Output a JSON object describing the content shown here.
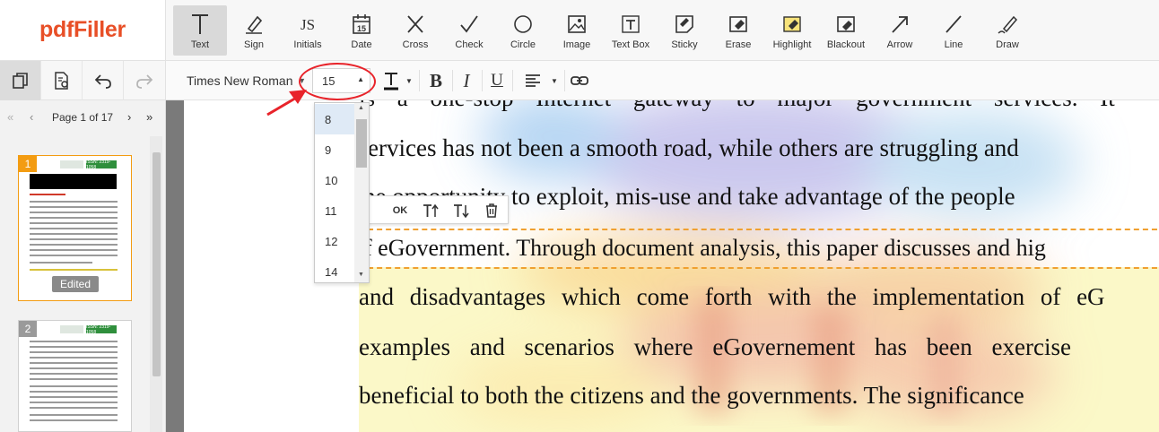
{
  "brand": {
    "logo_text": "pdfFiller"
  },
  "toolbar": {
    "tools": [
      {
        "id": "text",
        "label": "Text",
        "active": true
      },
      {
        "id": "sign",
        "label": "Sign"
      },
      {
        "id": "initials",
        "label": "Initials"
      },
      {
        "id": "date",
        "label": "Date"
      },
      {
        "id": "cross",
        "label": "Cross"
      },
      {
        "id": "check",
        "label": "Check"
      },
      {
        "id": "circle",
        "label": "Circle"
      },
      {
        "id": "image",
        "label": "Image"
      },
      {
        "id": "textbox",
        "label": "Text Box"
      },
      {
        "id": "sticky",
        "label": "Sticky"
      },
      {
        "id": "erase",
        "label": "Erase"
      },
      {
        "id": "highlight",
        "label": "Highlight"
      },
      {
        "id": "blackout",
        "label": "Blackout"
      },
      {
        "id": "arrow",
        "label": "Arrow"
      },
      {
        "id": "line",
        "label": "Line"
      },
      {
        "id": "draw",
        "label": "Draw"
      }
    ],
    "initials_glyph": "JS",
    "date_glyph": "15"
  },
  "format_bar": {
    "font_family": "Times New Roman",
    "font_size": "15",
    "bold_glyph": "B",
    "italic_glyph": "I",
    "underline_glyph": "U",
    "text_color_glyph": "T"
  },
  "font_size_dropdown": {
    "options": [
      "8",
      "9",
      "10",
      "11",
      "12",
      "14"
    ],
    "selected": "8"
  },
  "inline_toolbar": {
    "ok_label": "OK"
  },
  "sidebar": {
    "page_label": "Page 1 of 17",
    "pages": [
      {
        "number": "1",
        "badge": "Edited",
        "active": true
      },
      {
        "number": "2",
        "active": false
      }
    ],
    "thumb_header_text": "ISSN: 2319-1058",
    "accent_color": "#f39c12"
  },
  "document": {
    "lines": [
      "is a one-stop Internet gateway to major government services. It",
      "ervices has not been a smooth road, while others are struggling and",
      "he opportunity to exploit, mis-use and take advantage of the people",
      "f eGovernment. Through document analysis, this paper discusses and hig",
      "and disadvantages which come forth with the implementation of eG",
      "examples and scenarios where eGovernement has been exercise",
      "beneficial to both the citizens and the governments. The significance"
    ]
  },
  "colors": {
    "brand": "#e84f27",
    "annotation_red": "#e8232a",
    "dashed_selection": "#f0a030",
    "dropdown_selected": "#dfeaf6"
  }
}
